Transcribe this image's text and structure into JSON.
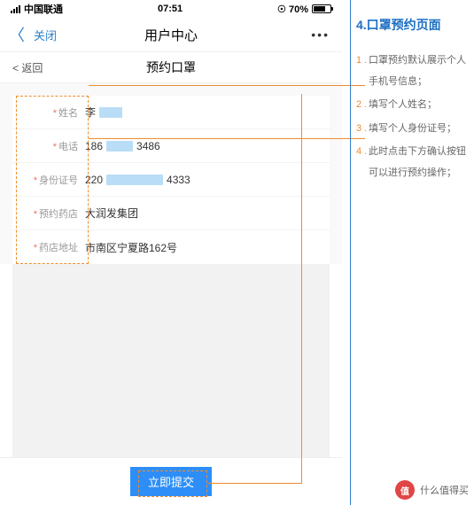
{
  "statusbar": {
    "carrier": "中国联通",
    "time": "07:51",
    "battery_pct": "70%"
  },
  "nav1": {
    "close": "关闭",
    "title": "用户中心",
    "more": "•••"
  },
  "nav2": {
    "back": "< 返回",
    "title": "预约口罩"
  },
  "form": {
    "name_label": "姓名",
    "name_value": "李",
    "phone_label": "电话",
    "phone_prefix": "186",
    "phone_suffix": "3486",
    "id_label": "身份证号",
    "id_prefix": "220",
    "id_suffix": "4333",
    "store_label": "预约药店",
    "store_value": "大润发集团",
    "addr_label": "药店地址",
    "addr_value": "市南区宁夏路162号"
  },
  "submit": {
    "label": "立即提交"
  },
  "right": {
    "title": "4.口罩预约页面",
    "notes": [
      "口罩预约默认展示个人手机号信息；",
      "填写个人姓名；",
      "填写个人身份证号；",
      "此时点击下方确认按钮可以进行预约操作；"
    ],
    "nums": [
      "1 .",
      "2 .",
      "3 .",
      "4 ."
    ]
  },
  "watermark": {
    "icon": "值",
    "text": "什么值得买"
  }
}
